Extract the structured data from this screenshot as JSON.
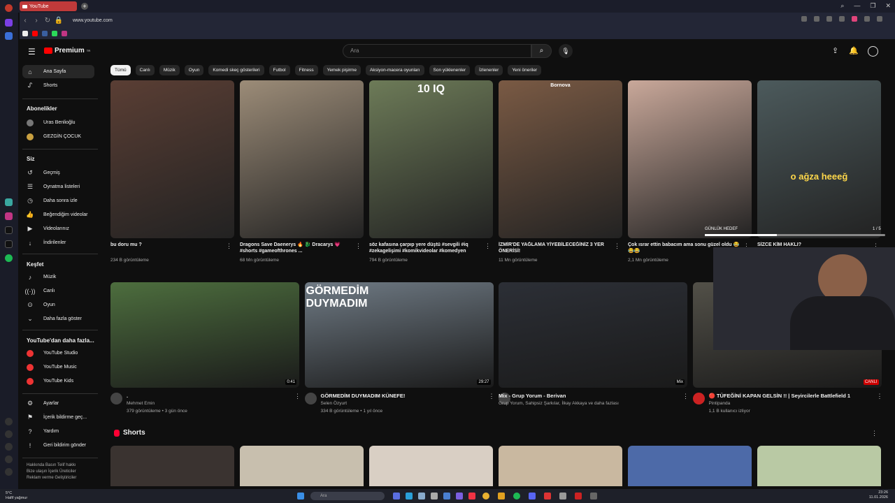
{
  "browser": {
    "tab_title": "YouTube",
    "url": "www.youtube.com"
  },
  "logo": {
    "text": "Premium",
    "badge": "TR"
  },
  "search": {
    "placeholder": "Ara"
  },
  "chips": [
    "Tümü",
    "Canlı",
    "Müzik",
    "Oyun",
    "Komedi skeç gösterileri",
    "Futbol",
    "Fitness",
    "Yemek pişirme",
    "Aksiyon-macera oyunları",
    "Son yüklenenler",
    "İzlenenler",
    "Yeni öneriler"
  ],
  "sidebar": {
    "main": [
      {
        "label": "Ana Sayfa",
        "icon": "home-icon"
      },
      {
        "label": "Shorts",
        "icon": "shorts-icon"
      }
    ],
    "subs_header": "Abonelikler",
    "subs": [
      {
        "label": "Uras Benlioğlu"
      },
      {
        "label": "GEZGİN ÇOCUK"
      }
    ],
    "you_header": "Siz",
    "you": [
      {
        "label": "Geçmiş"
      },
      {
        "label": "Oynatma listeleri"
      },
      {
        "label": "Daha sonra izle"
      },
      {
        "label": "Beğendiğim videolar"
      },
      {
        "label": "Videolarınız"
      },
      {
        "label": "İndirilenler"
      }
    ],
    "explore_header": "Keşfet",
    "explore": [
      {
        "label": "Müzik"
      },
      {
        "label": "Canlı"
      },
      {
        "label": "Oyun"
      },
      {
        "label": "Daha fazla göster"
      }
    ],
    "more_header": "YouTube'dan daha fazla...",
    "more": [
      {
        "label": "YouTube Studio"
      },
      {
        "label": "YouTube Music"
      },
      {
        "label": "YouTube Kids"
      }
    ],
    "settings": [
      {
        "label": "Ayarlar"
      },
      {
        "label": "İçerik bildirme geç..."
      },
      {
        "label": "Yardım"
      },
      {
        "label": "Geri bildirim gönder"
      }
    ],
    "footer1": "Hakkında  Basın  Telif hakkı",
    "footer2": "Bize ulaşın  İçerik Üreticiler",
    "footer3": "Reklam verme  Geliştiriciler"
  },
  "shorts": [
    {
      "title": "bu doru mu ?",
      "views": "234 B görüntüleme",
      "thumb_text": "",
      "color": "#5a3e34"
    },
    {
      "title": "Dragons Save Daenerys 🔥 🐉 Dracarys 💗 #shorts #gameofthrones ...",
      "views": "68 Mn görüntüleme",
      "thumb_text": "",
      "color": "#9c8c78"
    },
    {
      "title": "söz kafasına çarpıp yere düştü #sevgili #iq #zekagelişimi #komikvideolar #komedyen",
      "views": "794 B görüntüleme",
      "thumb_text": "10 IQ",
      "color": "#6d7b58"
    },
    {
      "title": "İZMİR'DE YAĞLAMA YİYEBİLECEĞİNİZ 3 YER ÖNERİSİ!",
      "views": "11 Mn görüntüleme",
      "thumb_text": "Bornova",
      "color": "#7a5a44"
    },
    {
      "title": "Çok ısrar ettin babacım ama sonu güzel oldu 😂😂😂",
      "views": "2,1 Mn görüntüleme",
      "thumb_text": "",
      "color": "#c9a89a"
    },
    {
      "title": "SİZCE KİM HAKLI?",
      "views": "",
      "thumb_text": "o ağza heeeğ",
      "color": "#4c5a5c"
    }
  ],
  "goal": {
    "label": "GÜNLÜK HEDEF",
    "count": "1 / 5"
  },
  "videos": [
    {
      "title": ".",
      "channel": "Mehmet Emin",
      "meta": "379 görüntüleme • 3 gün önce",
      "duration": "0:41",
      "color": "#4d6e3e"
    },
    {
      "title": "GÖRMEDİM DUYMADIM KÜNEFE!",
      "channel": "Selen Özyurt",
      "meta": "334 B görüntüleme • 1 yıl önce",
      "duration": "29:27",
      "thumb_text": "GÖRMEDİM DUYMADIM",
      "color": "#6f7a84"
    },
    {
      "title": "Mix - Grup Yorum - Berivan",
      "channel": "Grup Yorum, Sahipsiz Şarkılar, İlkay Akkaya ve daha fazlası",
      "meta": "",
      "duration": "Mix",
      "color": "#2c2f36"
    },
    {
      "title": "🔴 TÜFEĞİNİ KAPAN GELSİN !! | Seyircilerle Battlefield 1",
      "channel": "Pintipanda",
      "meta": "1,1 B kullanıcı izliyor",
      "duration": "CANLI",
      "color": "#525048"
    }
  ],
  "shorts_header": "Shorts",
  "taskbar": {
    "temp": "5°C",
    "weather": "Hafif yağmur",
    "search": "Ara",
    "time": "23:26",
    "date": "11.01.2026"
  }
}
